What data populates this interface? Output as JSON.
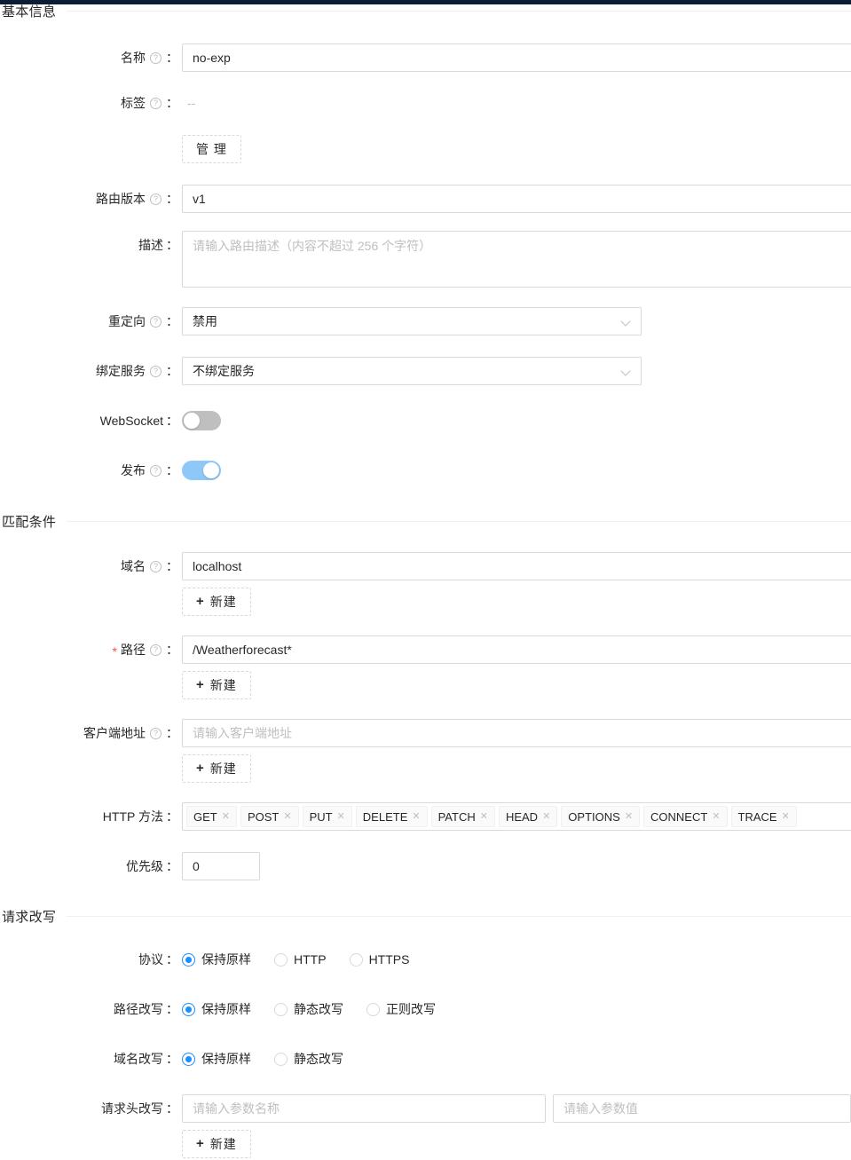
{
  "theme": {
    "topbar_color": "#0b1e33",
    "accent": "#1890ff",
    "switch_on": "#8ec8f8",
    "switch_off": "#bfbfbf",
    "required_star": "#ff4d4f",
    "border": "#d9d9d9"
  },
  "sections": {
    "basic": {
      "title": "基本信息"
    },
    "match": {
      "title": "匹配条件"
    },
    "rewrite": {
      "title": "请求改写"
    }
  },
  "basic": {
    "name": {
      "label": "名称",
      "help": "?",
      "colon": "：",
      "value": "no-exp"
    },
    "tags": {
      "label": "标签",
      "help": "?",
      "colon": "：",
      "value": "--",
      "manage_button": "管 理"
    },
    "route_version": {
      "label": "路由版本",
      "help": "?",
      "colon": "：",
      "value": "v1"
    },
    "description": {
      "label": "描述",
      "colon": "：",
      "placeholder": "请输入路由描述（内容不超过 256 个字符）",
      "value": ""
    },
    "redirect": {
      "label": "重定向",
      "help": "?",
      "colon": "：",
      "value": "禁用",
      "icon": "chevron-down-icon"
    },
    "bind_service": {
      "label": "绑定服务",
      "help": "?",
      "colon": "：",
      "value": "不绑定服务",
      "icon": "chevron-down-icon"
    },
    "websocket": {
      "label": "WebSocket",
      "colon": "：",
      "enabled": false
    },
    "publish": {
      "label": "发布",
      "help": "?",
      "colon": "：",
      "enabled": true
    }
  },
  "match": {
    "domain": {
      "label": "域名",
      "help": "?",
      "colon": "：",
      "value": "localhost",
      "add_button": "新建"
    },
    "path": {
      "label": "路径",
      "help": "?",
      "colon": "：",
      "required": "*",
      "value": "/Weatherforecast*",
      "add_button": "新建"
    },
    "client_address": {
      "label": "客户端地址",
      "help": "?",
      "colon": "：",
      "placeholder": "请输入客户端地址",
      "value": "",
      "add_button": "新建"
    },
    "http_methods": {
      "label": "HTTP 方法",
      "colon": "：",
      "values": [
        "GET",
        "POST",
        "PUT",
        "DELETE",
        "PATCH",
        "HEAD",
        "OPTIONS",
        "CONNECT",
        "TRACE"
      ],
      "remove_icon": "✕"
    },
    "priority": {
      "label": "优先级",
      "colon": "：",
      "value": "0"
    }
  },
  "rewrite": {
    "protocol": {
      "label": "协议",
      "colon": "：",
      "options": [
        "保持原样",
        "HTTP",
        "HTTPS"
      ],
      "selected": 0
    },
    "path_rewrite": {
      "label": "路径改写",
      "colon": "：",
      "options": [
        "保持原样",
        "静态改写",
        "正则改写"
      ],
      "selected": 0
    },
    "domain_rewrite": {
      "label": "域名改写",
      "colon": "：",
      "options": [
        "保持原样",
        "静态改写"
      ],
      "selected": 0
    },
    "header_rewrite": {
      "label": "请求头改写",
      "colon": "：",
      "key_placeholder": "请输入参数名称",
      "value_placeholder": "请输入参数值",
      "key_value": "",
      "value_value": "",
      "add_button": "新建"
    }
  },
  "icons": {
    "help": "help-circle-icon",
    "plus": "✚",
    "chevron": "chevron-down-icon"
  }
}
